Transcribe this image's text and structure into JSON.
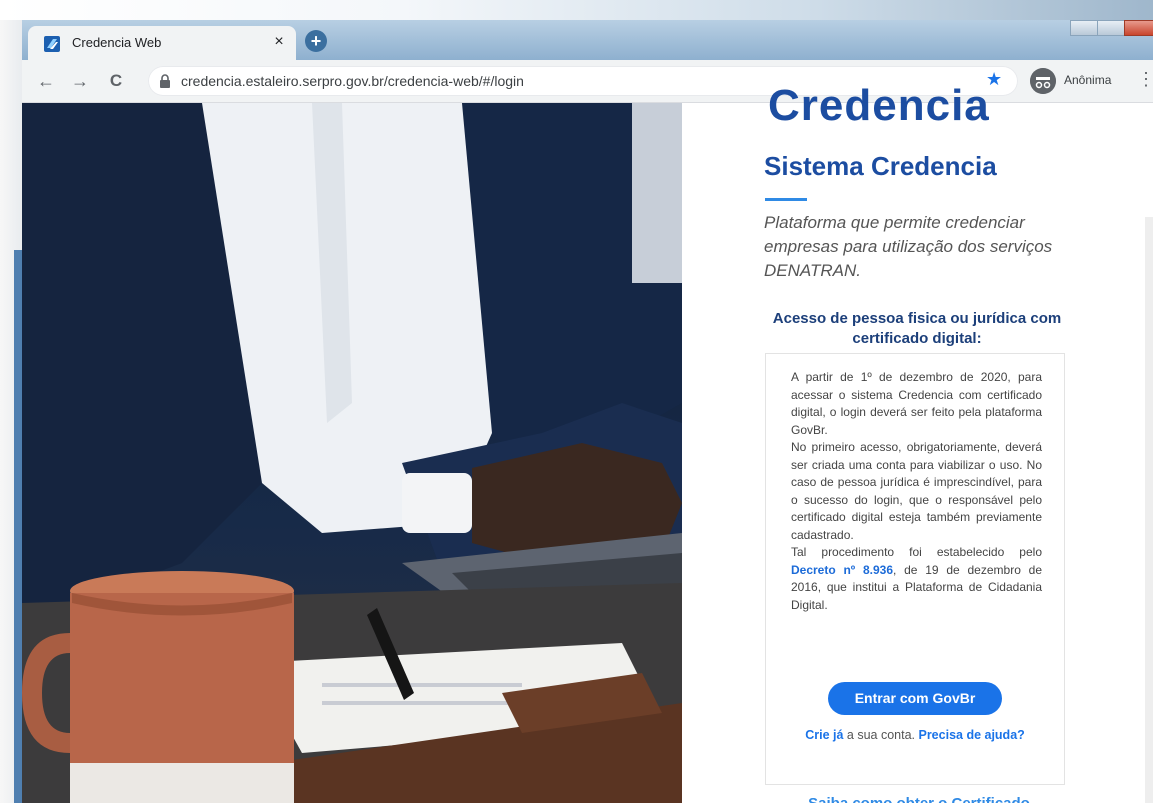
{
  "browser": {
    "tab_title": "Credencia Web",
    "tab_close": "×",
    "new_tab": "+",
    "url": "credencia.estaleiro.serpro.gov.br/credencia-web/#/login",
    "incognito_label": "Anônima",
    "back_glyph": "←",
    "forward_glyph": "→",
    "reload_glyph": "C",
    "star_glyph": "★",
    "menu_glyph": "⋮"
  },
  "page": {
    "brand_title": "Credencia",
    "system_title": "Sistema Credencia",
    "subtitle": "Plataforma que permite credenciar empresas para utilização dos serviços DENATRAN.",
    "access_heading": "Acesso de pessoa fisica ou jurídica com certificado digital:",
    "notice": {
      "p1": "A partir de 1º de dezembro de 2020, para acessar o sistema Credencia com certificado digital, o login deverá ser feito pela plataforma GovBr.",
      "p2": "No primeiro acesso, obrigatoriamente, deverá ser criada uma conta para viabilizar o uso. No caso de pessoa jurídica é imprescindível, para o sucesso do login, que o responsável pelo certificado digital esteja também previamente cadastrado.",
      "p3_before": "Tal procedimento foi estabelecido pelo",
      "decree_link": "Decreto nº 8.936",
      "p3_after": ", de 19 de dezembro de 2016, que institui a Plataforma de Cidadania Digital."
    },
    "govbr_button": "Entrar com GovBr",
    "create_link": "Crie já",
    "create_text": " a sua conta. ",
    "help_link": "Precisa de ajuda?",
    "saiba_heading": "Saiba como obter o Certificado"
  },
  "colors": {
    "brand_blue": "#1c4da1",
    "accent_blue": "#1a73e8",
    "link_blue": "#2f8ae5"
  }
}
